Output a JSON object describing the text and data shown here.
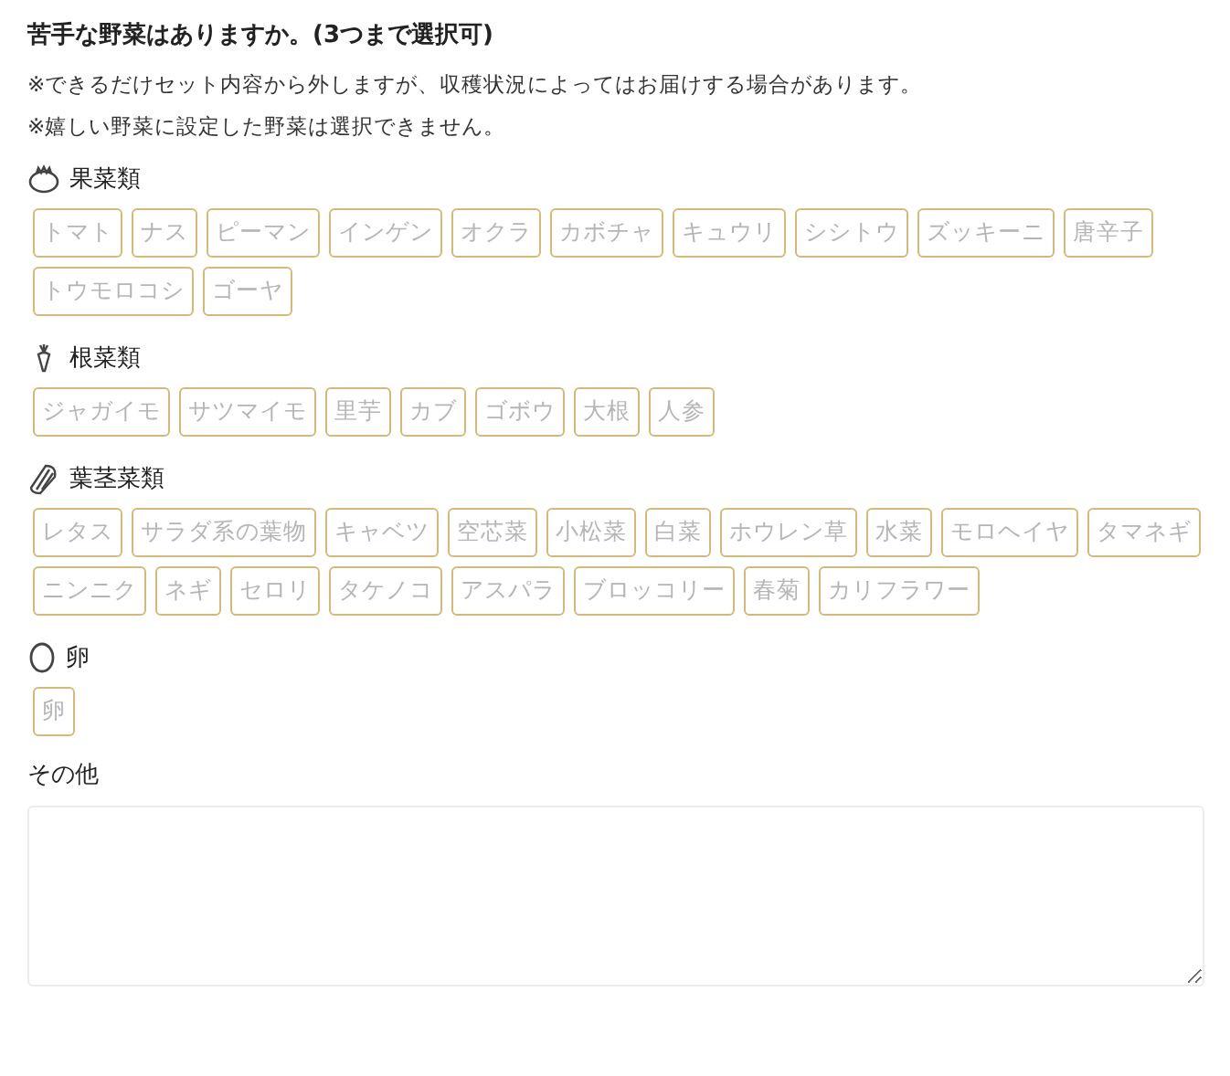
{
  "question": {
    "title": "苦手な野菜はありますか。(3つまで選択可)",
    "notes": [
      "※できるだけセット内容から外しますが、収穫状況によってはお届けする場合があります。",
      "※嬉しい野菜に設定した野菜は選択できません。"
    ]
  },
  "categories": [
    {
      "kind": "tomato",
      "label": "果菜類",
      "options": [
        {
          "label": "トマト",
          "selected": false
        },
        {
          "label": "ナス",
          "selected": false
        },
        {
          "label": "ピーマン",
          "selected": false
        },
        {
          "label": "インゲン",
          "selected": false
        },
        {
          "label": "オクラ",
          "selected": false
        },
        {
          "label": "カボチャ",
          "selected": false
        },
        {
          "label": "キュウリ",
          "selected": false
        },
        {
          "label": "シシトウ",
          "selected": false
        },
        {
          "label": "ズッキーニ",
          "selected": false
        },
        {
          "label": "唐辛子",
          "selected": false
        },
        {
          "label": "トウモロコシ",
          "selected": false
        },
        {
          "label": "ゴーヤ",
          "selected": false
        }
      ]
    },
    {
      "kind": "carrot",
      "label": "根菜類",
      "options": [
        {
          "label": "ジャガイモ",
          "selected": false
        },
        {
          "label": "サツマイモ",
          "selected": false
        },
        {
          "label": "里芋",
          "selected": false
        },
        {
          "label": "カブ",
          "selected": false
        },
        {
          "label": "ゴボウ",
          "selected": false
        },
        {
          "label": "大根",
          "selected": false
        },
        {
          "label": "人参",
          "selected": false
        }
      ]
    },
    {
      "kind": "leaf",
      "label": "葉茎菜類",
      "options": [
        {
          "label": "レタス",
          "selected": false
        },
        {
          "label": "サラダ系の葉物",
          "selected": false
        },
        {
          "label": "キャベツ",
          "selected": false
        },
        {
          "label": "空芯菜",
          "selected": false
        },
        {
          "label": "小松菜",
          "selected": false
        },
        {
          "label": "白菜",
          "selected": false
        },
        {
          "label": "ホウレン草",
          "selected": false
        },
        {
          "label": "水菜",
          "selected": false
        },
        {
          "label": "モロヘイヤ",
          "selected": false
        },
        {
          "label": "タマネギ",
          "selected": false
        },
        {
          "label": "ニンニク",
          "selected": false
        },
        {
          "label": "ネギ",
          "selected": false
        },
        {
          "label": "セロリ",
          "selected": false
        },
        {
          "label": "タケノコ",
          "selected": false
        },
        {
          "label": "アスパラ",
          "selected": false
        },
        {
          "label": "ブロッコリー",
          "selected": false
        },
        {
          "label": "春菊",
          "selected": false
        },
        {
          "label": "カリフラワー",
          "selected": false
        }
      ]
    },
    {
      "kind": "egg",
      "label": "卵",
      "options": [
        {
          "label": "卵",
          "selected": false
        }
      ]
    }
  ],
  "other": {
    "label": "その他"
  }
}
